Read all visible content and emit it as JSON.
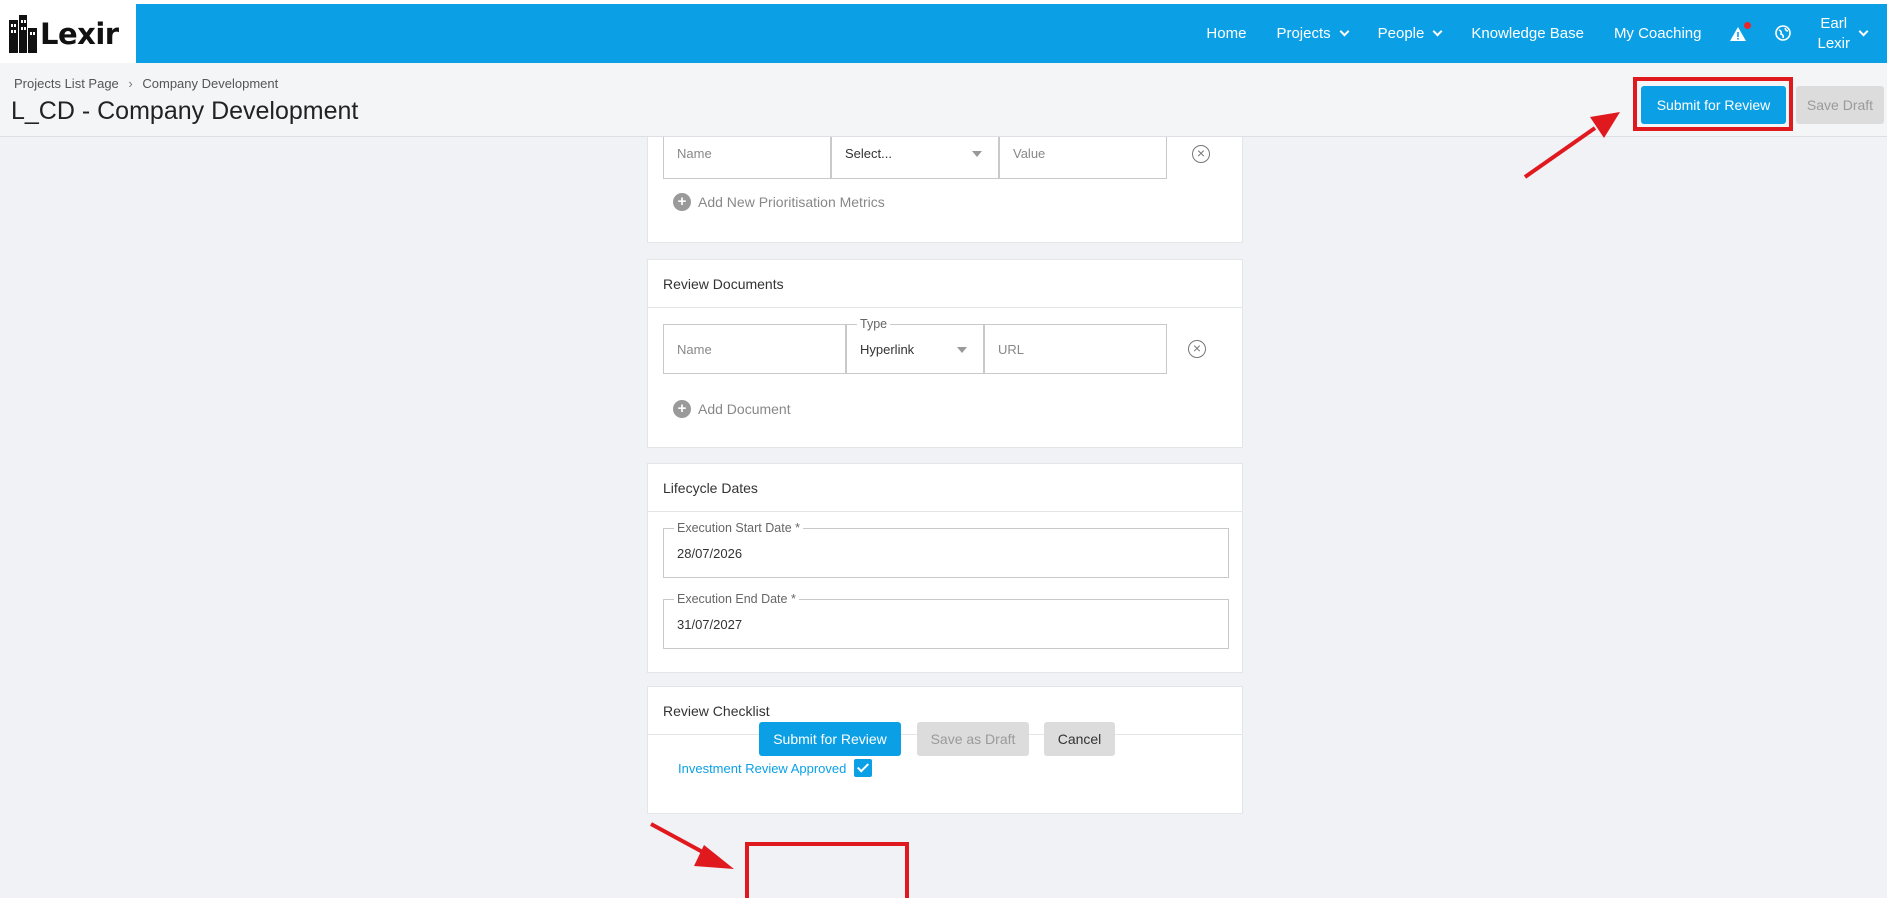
{
  "brand": {
    "name": "Lexir"
  },
  "nav": {
    "home": "Home",
    "projects": "Projects",
    "people": "People",
    "knowledge_base": "Knowledge Base",
    "my_coaching": "My Coaching",
    "user_first": "Earl",
    "user_last": "Lexir"
  },
  "breadcrumb": {
    "parent": "Projects List Page",
    "separator": "›",
    "current": "Company Development"
  },
  "page_title": "L_CD - Company Development",
  "header_actions": {
    "submit": "Submit for Review",
    "save": "Save Draft"
  },
  "metrics": {
    "name_placeholder": "Name",
    "select_placeholder": "Select...",
    "value_placeholder": "Value",
    "add_label": "Add New Prioritisation Metrics"
  },
  "review_documents": {
    "title": "Review Documents",
    "name_placeholder": "Name",
    "type_legend": "Type",
    "type_value": "Hyperlink",
    "url_placeholder": "URL",
    "add_label": "Add Document"
  },
  "lifecycle": {
    "title": "Lifecycle Dates",
    "start_label": "Execution Start Date *",
    "start_value": "28/07/2026",
    "end_label": "Execution End Date *",
    "end_value": "31/07/2027"
  },
  "checklist": {
    "title": "Review Checklist",
    "item_label": "Investment Review Approved",
    "item_checked": true
  },
  "footer_actions": {
    "submit": "Submit for Review",
    "save": "Save as Draft",
    "cancel": "Cancel"
  },
  "colors": {
    "primary": "#0ba0e6",
    "annotation": "#e0191f",
    "disabled": "#dcdcdc"
  },
  "icons": {
    "alert": "warning-triangle-icon",
    "language": "globe-icon",
    "remove": "circle-x-icon",
    "add": "plus-circle-icon"
  }
}
